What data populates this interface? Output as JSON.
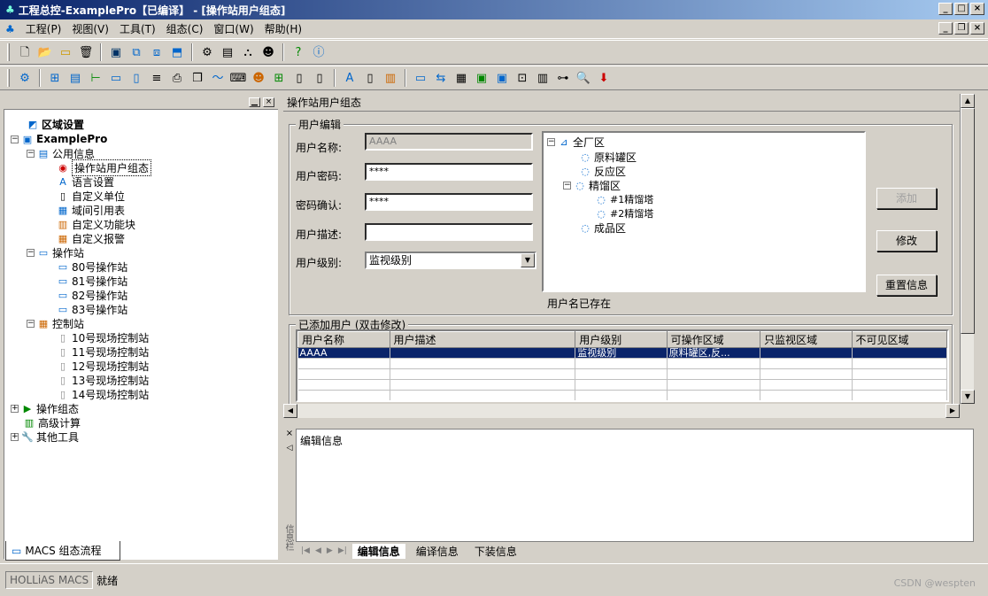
{
  "window": {
    "title": "工程总控-ExamplePro【已编译】 - [操作站用户组态]"
  },
  "menu": [
    "工程(P)",
    "视图(V)",
    "工具(T)",
    "组态(C)",
    "窗口(W)",
    "帮助(H)"
  ],
  "left_tree": {
    "root": "区域设置",
    "project": "ExamplePro",
    "public": "公用信息",
    "public_items": [
      "操作站用户组态",
      "语言设置",
      "自定义单位",
      "域间引用表",
      "自定义功能块",
      "自定义报警"
    ],
    "ops": "操作站",
    "ops_items": [
      "80号操作站",
      "81号操作站",
      "82号操作站",
      "83号操作站"
    ],
    "ctrl": "控制站",
    "ctrl_items": [
      "10号现场控制站",
      "11号现场控制站",
      "12号现场控制站",
      "13号现场控制站",
      "14号现场控制站"
    ],
    "others": [
      "操作组态",
      "高级计算",
      "其他工具"
    ],
    "tab": "MACS 组态流程"
  },
  "panel": {
    "header": "操作站用户组态",
    "group_edit": "用户编辑",
    "labels": {
      "name": "用户名称:",
      "password": "用户密码:",
      "confirm": "密码确认:",
      "desc": "用户描述:",
      "level": "用户级别:"
    },
    "values": {
      "name": "AAAA",
      "password": "****",
      "confirm": "****",
      "desc": "",
      "level": "监视级别"
    },
    "area_tree": {
      "root": "全厂区",
      "items": [
        "原料罐区",
        "反应区",
        "精馏区",
        "#1精馏塔",
        "#2精馏塔",
        "成品区"
      ]
    },
    "status_msg": "用户名已存在",
    "buttons": {
      "add": "添加",
      "modify": "修改",
      "reset": "重置信息"
    },
    "group_users": "已添加用户 (双击修改)",
    "columns": [
      "用户名称",
      "用户描述",
      "用户级别",
      "可操作区域",
      "只监视区域",
      "不可见区域"
    ],
    "rows": [
      [
        "AAAA",
        "",
        "监视级别",
        "原料罐区,反...",
        "",
        ""
      ]
    ]
  },
  "bottom": {
    "title": "编辑信息",
    "side_label": "信息栏",
    "tabs": [
      "编辑信息",
      "编译信息",
      "下装信息"
    ]
  },
  "status": {
    "product": "HOLLiAS MACS",
    "state": "就绪",
    "watermark": "CSDN @wespten"
  }
}
